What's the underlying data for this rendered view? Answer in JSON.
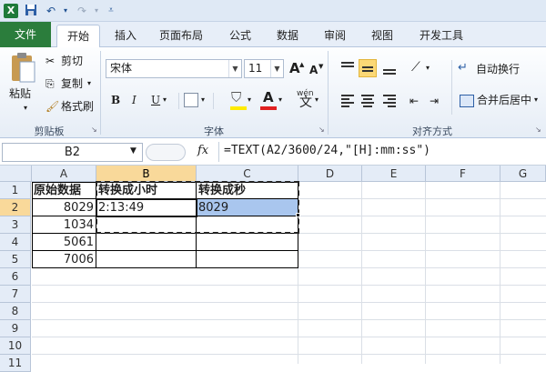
{
  "titlebar": {
    "logo": "X",
    "save_icon": "save-icon",
    "undo_icon": "undo-icon",
    "redo_icon": "redo-icon",
    "customize_icon": "customize-icon"
  },
  "tabs": [
    "文件",
    "开始",
    "插入",
    "页面布局",
    "公式",
    "数据",
    "审阅",
    "视图",
    "开发工具"
  ],
  "ribbon": {
    "clipboard": {
      "paste": "粘贴",
      "cut": "剪切",
      "copy": "复制",
      "format_painter": "格式刷",
      "label": "剪贴板"
    },
    "font": {
      "family": "宋体",
      "size": "11",
      "grow": "A",
      "shrink": "A",
      "bold": "B",
      "italic": "I",
      "underline": "U",
      "font_color_letter": "A",
      "phonetic": "wén",
      "label": "字体"
    },
    "alignment": {
      "wrap_text": "自动换行",
      "merge_center": "合并后居中",
      "label": "对齐方式"
    }
  },
  "formula_bar": {
    "name_box": "B2",
    "fx": "fx",
    "formula": "=TEXT(A2/3600/24,\"[H]:mm:ss\")"
  },
  "sheet": {
    "columns": [
      "A",
      "B",
      "C",
      "D",
      "E",
      "F",
      "G"
    ],
    "rows": [
      "1",
      "2",
      "3",
      "4",
      "5",
      "6",
      "7",
      "8",
      "9",
      "10",
      "11"
    ],
    "cells": {
      "A1": "原始数据",
      "B1": "转换成小时",
      "C1": "转换成秒",
      "A2": "8029",
      "B2": "2:13:49",
      "C2": "8029",
      "A3": "1034",
      "A4": "5061",
      "A5": "7006"
    },
    "selected_cell": "B2"
  },
  "colors": {
    "file_tab": "#2b7d3c",
    "header_bg": "#e4ecf7",
    "selected_header": "#f9d99a",
    "selection_fill": "#a9c6ee"
  }
}
